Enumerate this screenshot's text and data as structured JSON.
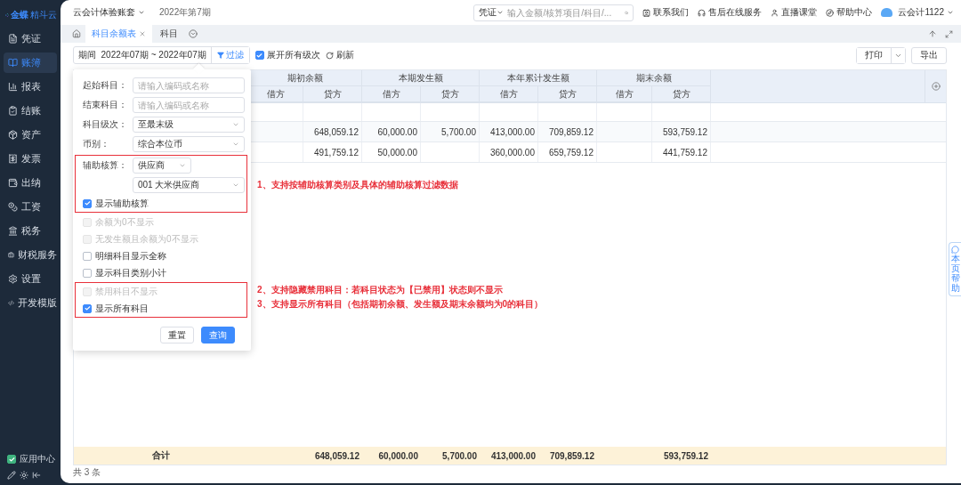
{
  "sidebar": {
    "logo": {
      "brand": "金蝶",
      "product": "精斗云"
    },
    "items": [
      {
        "label": "凭证",
        "selected": false
      },
      {
        "label": "账簿",
        "selected": true
      },
      {
        "label": "报表",
        "selected": false
      },
      {
        "label": "结账",
        "selected": false
      },
      {
        "label": "资产",
        "selected": false
      },
      {
        "label": "发票",
        "selected": false
      },
      {
        "label": "出纳",
        "selected": false
      },
      {
        "label": "工资",
        "selected": false
      },
      {
        "label": "税务",
        "selected": false
      },
      {
        "label": "财税服务",
        "selected": false
      },
      {
        "label": "设置",
        "selected": false
      },
      {
        "label": "开发模版",
        "selected": false
      }
    ],
    "footer": {
      "label": "应用中心",
      "checked": true
    }
  },
  "topbar": {
    "account": "云会计体验账套",
    "period": "2022年第7期",
    "search": {
      "scope": "凭证",
      "placeholder": "输入金额/核算项目/科目/..."
    },
    "links": [
      "联系我们",
      "售后在线服务",
      "直播课堂",
      "帮助中心"
    ],
    "user": "云会计1122"
  },
  "tabs": [
    {
      "label": "科目余额表",
      "selected": true,
      "closable": true
    },
    {
      "label": "科目",
      "selected": false,
      "closable": false
    }
  ],
  "toolbar": {
    "period_label": "期间",
    "period_value": "2022年07期 ~ 2022年07期",
    "filter": "过滤",
    "expand_all": {
      "label": "展开所有级次",
      "checked": true
    },
    "refresh": "刷新",
    "print": "打印",
    "export": "导出"
  },
  "table": {
    "groups": [
      "期初余额",
      "本期发生额",
      "本年累计发生额",
      "期末余额"
    ],
    "subcolumns": [
      "借方",
      "贷方",
      "借方",
      "贷方",
      "借方",
      "贷方",
      "借方",
      "贷方"
    ],
    "rows": [
      {
        "kind": "blank"
      },
      {
        "kind": "data",
        "opening_credit": "648,059.12",
        "period_debit": "60,000.00",
        "period_credit": "5,700.00",
        "ytd_debit": "413,000.00",
        "ytd_credit": "709,859.12",
        "closing_credit": "593,759.12"
      },
      {
        "kind": "data",
        "opening_credit": "491,759.12",
        "period_debit": "50,000.00",
        "ytd_debit": "360,000.00",
        "ytd_credit": "659,759.12",
        "closing_credit": "441,759.12"
      }
    ],
    "total": {
      "label": "合计",
      "opening_credit": "648,059.12",
      "period_debit": "60,000.00",
      "period_credit": "5,700.00",
      "ytd_debit": "413,000.00",
      "ytd_credit": "709,859.12",
      "closing_credit": "593,759.12"
    },
    "footer": "共 3 条"
  },
  "notes": [
    {
      "lines": [
        "1、支持按辅助核算类别及具体的辅助核算过滤数据"
      ]
    },
    {
      "lines": [
        "2、支持隐藏禁用科目：若科目状态为【已禁用】状态则不显示",
        "3、支持显示所有科目（包括期初余额、发生额及期末余额均为0的科目）"
      ]
    }
  ],
  "filter_panel": {
    "groups": [
      {
        "highlighted": false,
        "items": [
          {
            "kind": "input",
            "label": "起始科目：",
            "placeholder": "请输入编码或名称"
          },
          {
            "kind": "input",
            "label": "结束科目：",
            "placeholder": "请输入编码或名称"
          },
          {
            "kind": "select",
            "label": "科目级次：",
            "value": "至最末级"
          },
          {
            "kind": "select",
            "label": "币别：",
            "value": "综合本位币"
          }
        ]
      },
      {
        "highlighted": true,
        "items": [
          {
            "kind": "short-select",
            "label": "辅助核算：",
            "value": "供应商"
          },
          {
            "kind": "select",
            "value": "001 大米供应商"
          },
          {
            "kind": "checkbox",
            "label": "显示辅助核算",
            "checked": true,
            "disabled": false
          }
        ]
      },
      {
        "highlighted": false,
        "items": [
          {
            "kind": "checkbox",
            "label": "余额为0不显示",
            "checked": false,
            "disabled": true
          },
          {
            "kind": "checkbox",
            "label": "无发生额且余额为0不显示",
            "checked": false,
            "disabled": true
          },
          {
            "kind": "checkbox",
            "label": "明细科目显示全称",
            "checked": false,
            "disabled": false
          },
          {
            "kind": "checkbox",
            "label": "显示科目类别小计",
            "checked": false,
            "disabled": false
          }
        ]
      },
      {
        "highlighted": true,
        "items": [
          {
            "kind": "checkbox",
            "label": "禁用科目不显示",
            "checked": false,
            "disabled": true
          },
          {
            "kind": "checkbox",
            "label": "显示所有科目",
            "checked": true,
            "disabled": false
          }
        ]
      }
    ],
    "buttons": [
      {
        "label": "重置",
        "kind": "secondary"
      },
      {
        "label": "查询",
        "kind": "primary"
      }
    ]
  },
  "help_tab": "本页帮助"
}
